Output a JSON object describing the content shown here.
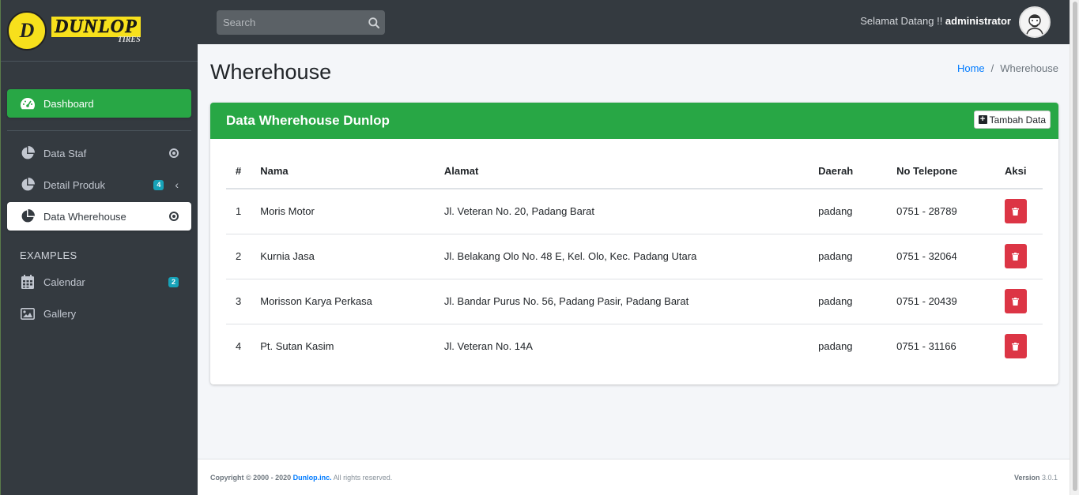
{
  "brand": {
    "logo_letter": "D",
    "name": "DUNLOP",
    "sub": "TIRES"
  },
  "sidebar": {
    "items": [
      {
        "label": "Dashboard",
        "icon": "tachometer-icon"
      },
      {
        "label": "Data Staf",
        "icon": "pie-chart-icon"
      },
      {
        "label": "Detail Produk",
        "icon": "pie-chart-icon",
        "badge": "4"
      },
      {
        "label": "Data Wherehouse",
        "icon": "pie-chart-icon"
      }
    ],
    "examples_header": "EXAMPLES",
    "examples": [
      {
        "label": "Calendar",
        "icon": "calendar-icon",
        "badge": "2"
      },
      {
        "label": "Gallery",
        "icon": "image-icon"
      }
    ]
  },
  "topbar": {
    "search_placeholder": "Search",
    "welcome_prefix": "Selamat Datang !! ",
    "username": "administrator"
  },
  "page": {
    "title": "Wherehouse",
    "breadcrumb": {
      "home": "Home",
      "separator": "/",
      "current": "Wherehouse"
    }
  },
  "card": {
    "title": "Data Wherehouse Dunlop",
    "add_label": "Tambah Data",
    "columns": [
      "#",
      "Nama",
      "Alamat",
      "Daerah",
      "No Telepone",
      "Aksi"
    ],
    "rows": [
      {
        "no": "1",
        "nama": "Moris Motor",
        "alamat": "Jl. Veteran No. 20, Padang Barat",
        "daerah": "padang",
        "telp": "0751 - 28789"
      },
      {
        "no": "2",
        "nama": "Kurnia Jasa",
        "alamat": "Jl. Belakang Olo No. 48 E, Kel. Olo, Kec. Padang Utara",
        "daerah": "padang",
        "telp": "0751 - 32064"
      },
      {
        "no": "3",
        "nama": "Morisson Karya Perkasa",
        "alamat": "Jl. Bandar Purus No. 56, Padang Pasir, Padang Barat",
        "daerah": "padang",
        "telp": "0751 - 20439"
      },
      {
        "no": "4",
        "nama": "Pt. Sutan Kasim",
        "alamat": "Jl. Veteran No. 14A",
        "daerah": "padang",
        "telp": "0751 - 31166"
      }
    ]
  },
  "footer": {
    "copyright": "Copyright © 2000 - 2020 ",
    "company": "Dunlop.inc.",
    "rights": " All rights reserved.",
    "version_label": "Version",
    "version": " 3.0.1"
  },
  "colors": {
    "sidebar_bg": "#343a40",
    "accent_green": "#28a745",
    "danger": "#dc3545",
    "info": "#17a2b8",
    "link": "#007bff"
  }
}
